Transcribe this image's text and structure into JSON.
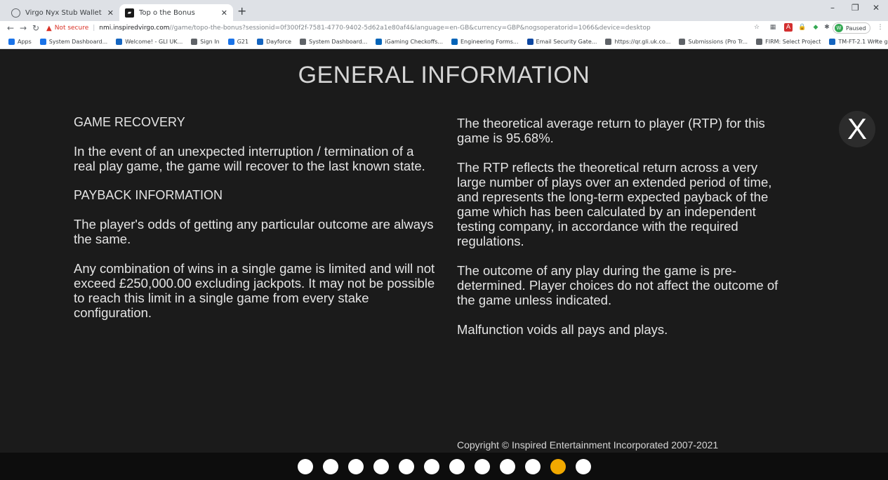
{
  "browser": {
    "tabs": [
      {
        "title": "Virgo Nyx Stub Wallet",
        "active": false
      },
      {
        "title": "Top o the Bonus",
        "active": true
      }
    ],
    "new_tab": "+",
    "window_controls": {
      "minimize": "–",
      "maximize": "❐",
      "close": "✕"
    },
    "address": {
      "warning": "Not secure",
      "host": "nmi.inspiredvirgo.com",
      "path": "//game/topo-the-bonus?sessionid=0f300f2f-7581-4770-9402-5d62a1e80af4&language=en-GB&currency=GBP&nogsoperatorid=1066&device=desktop"
    },
    "profile_label": "Paused",
    "profile_initial": "W",
    "bookmarks": [
      {
        "label": "Apps",
        "color": "#1a73e8"
      },
      {
        "label": "System Dashboard...",
        "color": "#1a73e8"
      },
      {
        "label": "Welcome! - GLI UK...",
        "color": "#1565c0"
      },
      {
        "label": "Sign In",
        "color": "#5f6368"
      },
      {
        "label": "G21",
        "color": "#1a73e8"
      },
      {
        "label": "Dayforce",
        "color": "#1565c0"
      },
      {
        "label": "System Dashboard...",
        "color": "#5f6368"
      },
      {
        "label": "iGaming Checkoffs...",
        "color": "#0364b8"
      },
      {
        "label": "Engineering Forms...",
        "color": "#0364b8"
      },
      {
        "label": "Email Security Gate...",
        "color": "#0d47a1"
      },
      {
        "label": "https://qr.gli.uk.co...",
        "color": "#5f6368"
      },
      {
        "label": "Submissions (Pro Tr...",
        "color": "#5f6368"
      },
      {
        "label": "FIRM: Select Project",
        "color": "#5f6368"
      },
      {
        "label": "TM-FT-2.1 Write ga...",
        "color": "#1565c0"
      }
    ],
    "bookmarks_more": "»"
  },
  "game": {
    "title": "GENERAL INFORMATION",
    "close_label": "X",
    "left_column": {
      "recovery_heading": "GAME RECOVERY",
      "recovery_text": "In the event of an unexpected interruption / termination of a real play game, the game will recover to the last known state.",
      "payback_heading": "PAYBACK INFORMATION",
      "payback_text_1": "The player's odds of getting any particular outcome are always the same.",
      "payback_text_2": "Any combination of wins in a single game is limited and will not exceed £250,000.00 excluding jackpots. It may not be possible to reach this limit in a single game from every stake configuration."
    },
    "right_column": {
      "rtp_text": "The theoretical average return to player (RTP) for this game is 95.68%.",
      "rtp_explain": "The RTP reflects the theoretical return across a very large number of plays over an extended period of time, and represents the long-term expected payback of the game which has been calculated by an independent testing company, in accordance with the required regulations.",
      "outcome_text": "The outcome of any play during the game is pre-determined. Player choices do not affect the outcome of the game unless indicated.",
      "malfunction_text": "Malfunction voids all pays and plays."
    },
    "copyright": "Copyright © Inspired Entertainment Incorporated 2007-2021",
    "pagination": {
      "total_pages": 12,
      "current_page": 11,
      "active_color": "#f2a900"
    }
  }
}
